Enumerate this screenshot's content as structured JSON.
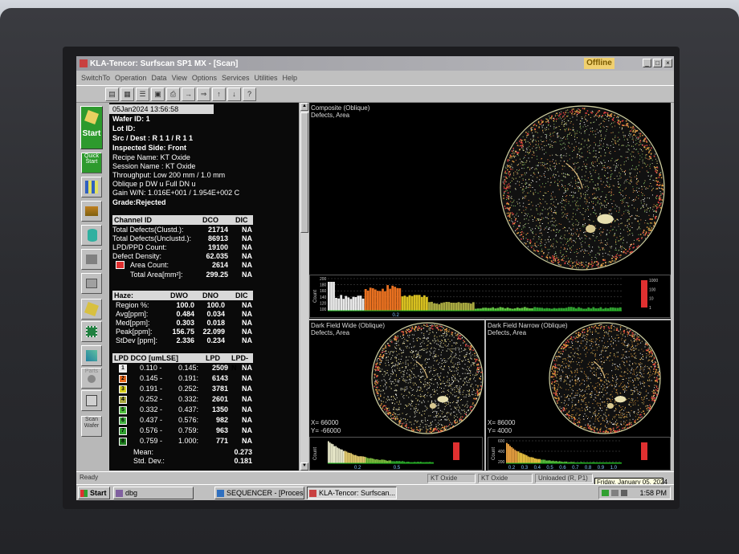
{
  "window": {
    "title": "KLA-Tencor:  Surfscan SP1 MX   - [Scan]",
    "status": "Offline"
  },
  "menu": [
    "SwitchTo",
    "Operation",
    "Data",
    "View",
    "Options",
    "Services",
    "Utilities",
    "Help"
  ],
  "toolbar_icons": [
    "open-icon",
    "new-icon",
    "list-icon",
    "save-icon",
    "print-icon",
    "arrow-right-icon",
    "arrow-double-right-icon",
    "up-icon",
    "down-icon",
    "help-icon"
  ],
  "sidebar": {
    "start_label": "Start",
    "quick_label": "Quick Start",
    "parts_label": "Parts",
    "scan_label": "Scan Wafer"
  },
  "info": {
    "datetime": "05Jan2024  13:56:58",
    "wafer_id": "Wafer ID: 1",
    "lot_id": "Lot ID:",
    "src_dest": "Src / Dest :  R 1    1   /    R 1     1",
    "side": "Inspected Side: Front",
    "recipe": "Recipe Name:  KT Oxide",
    "session": "Session Name :  KT Oxide",
    "throughput": "Throughput:  Low    200  mm  /  1.0  mm",
    "oblique": "Oblique  p  DW  u  Full    DN  u",
    "gain": "Gain W/N: 1.016E+001 / 1.954E+002  C",
    "grade": "Grade:Rejected"
  },
  "channel": {
    "headers": [
      "Channel ID",
      "DCO",
      "DIC"
    ],
    "rows": [
      {
        "label": "Total Defects(Clustd.):",
        "dco": "21714",
        "dic": "NA"
      },
      {
        "label": "Total Defects(Unclustd.):",
        "dco": "86913",
        "dic": "NA"
      },
      {
        "label": "LPD/PPD Count:",
        "dco": "19100",
        "dic": "NA"
      },
      {
        "label": "Defect Density:",
        "dco": "62.035",
        "dic": "NA"
      },
      {
        "label": "Area Count:",
        "dco": "2614",
        "dic": "NA"
      },
      {
        "label": "Total Area[mm²]:",
        "dco": "299.25",
        "dic": "NA"
      }
    ]
  },
  "haze": {
    "headers": [
      "Haze:",
      "DWO",
      "DNO",
      "DIC"
    ],
    "rows": [
      {
        "label": "Region %:",
        "dwo": "100.0",
        "dno": "100.0",
        "dic": "NA"
      },
      {
        "label": "Avg[ppm]:",
        "dwo": "0.484",
        "dno": "0.034",
        "dic": "NA"
      },
      {
        "label": "Med[ppm]:",
        "dwo": "0.303",
        "dno": "0.018",
        "dic": "NA"
      },
      {
        "label": "Peak[ppm]:",
        "dwo": "156.75",
        "dno": "22.099",
        "dic": "NA"
      },
      {
        "label": "StDev [ppm]:",
        "dwo": "2.336",
        "dno": "0.234",
        "dic": "NA"
      }
    ]
  },
  "lpd": {
    "headers": [
      "LPD DCO  [umLSE]",
      "LPD",
      "LPD-N"
    ],
    "rows": [
      {
        "bin": "1",
        "color": "#e8e8e8",
        "from": "0.110 -",
        "to": "0.145:",
        "lpd": "2509",
        "lpdn": "NA"
      },
      {
        "bin": "2",
        "color": "#e86a20",
        "from": "0.145 -",
        "to": "0.191:",
        "lpd": "6143",
        "lpdn": "NA"
      },
      {
        "bin": "3",
        "color": "#d8d020",
        "from": "0.191 -",
        "to": "0.252:",
        "lpd": "3781",
        "lpdn": "NA"
      },
      {
        "bin": "4",
        "color": "#a8a840",
        "from": "0.252 -",
        "to": "0.332:",
        "lpd": "2601",
        "lpdn": "NA"
      },
      {
        "bin": "5",
        "color": "#50c040",
        "from": "0.332 -",
        "to": "0.437:",
        "lpd": "1350",
        "lpdn": "NA"
      },
      {
        "bin": "6",
        "color": "#40b040",
        "from": "0.437 -",
        "to": "0.576:",
        "lpd": "982",
        "lpdn": "NA"
      },
      {
        "bin": "7",
        "color": "#30a030",
        "from": "0.576 -",
        "to": "0.759:",
        "lpd": "963",
        "lpdn": "NA"
      },
      {
        "bin": "8",
        "color": "#208020",
        "from": "0.759 -",
        "to": "1.000:",
        "lpd": "771",
        "lpdn": "NA"
      }
    ],
    "mean_label": "Mean:",
    "mean": "0.273",
    "std_label": "Std. Dev.:",
    "std": "0.181"
  },
  "panels": {
    "composite": {
      "title": "Composite (Oblique)",
      "sub": "Defects, Area"
    },
    "wide": {
      "title": "Dark Field Wide (Oblique)",
      "sub": "Defects, Area",
      "x": "X=    66000",
      "y": "Y=  -66000"
    },
    "narrow": {
      "title": "Dark Field Narrow (Oblique)",
      "sub": "Defects, Area",
      "x": "X=    86000",
      "y": "Y=      4000"
    }
  },
  "hist_main": {
    "ylabel": "Count",
    "yticks": [
      "200",
      "180",
      "160",
      "140",
      "120",
      "100"
    ],
    "xtick": "0.2",
    "scale_labels": [
      "1000",
      "100",
      "10",
      "1"
    ]
  },
  "hist_wide": {
    "ylabel": "Count",
    "xticks": [
      "0.2",
      "0.5"
    ]
  },
  "hist_narrow": {
    "ylabel": "Count",
    "yticks": [
      "600",
      "400",
      "200"
    ],
    "xticks": [
      "0.2",
      "0.3",
      "0.4",
      "0.5",
      "0.6",
      "0.7",
      "0.8",
      "0.9",
      "1.0"
    ]
  },
  "statusbar": {
    "ready": "Ready",
    "ch1": "KT Oxide",
    "ch2": "KT Oxide",
    "ch3": "Unloaded (R, P1)",
    "tooltip": "Friday, January 05, 2024"
  },
  "taskbar": {
    "start": "Start",
    "t1": "dbg",
    "t2": "SEQUENCER - [Processor]",
    "t3": "KLA-Tencor:  Surfscan...",
    "clock": "1:58 PM"
  }
}
